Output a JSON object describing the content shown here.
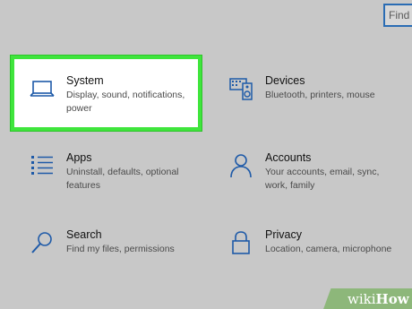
{
  "search": {
    "value": "Find"
  },
  "tiles": [
    {
      "title": "System",
      "desc": "Display, sound, notifications, power",
      "icon": "laptop-icon"
    },
    {
      "title": "Devices",
      "desc": "Bluetooth, printers, mouse",
      "icon": "keyboard-speaker-icon"
    },
    {
      "title": "Apps",
      "desc": "Uninstall, defaults, optional features",
      "icon": "apps-list-icon"
    },
    {
      "title": "Accounts",
      "desc": "Your accounts, email, sync, work, family",
      "icon": "person-icon"
    },
    {
      "title": "Search",
      "desc": "Find my files, permissions",
      "icon": "magnifier-icon"
    },
    {
      "title": "Privacy",
      "desc": "Location, camera, microphone",
      "icon": "lock-icon"
    }
  ],
  "watermark": {
    "prefix": "wiki",
    "suffix": "How"
  },
  "colors": {
    "accent": "#1e5aa8",
    "highlight_border": "#3fe53c"
  }
}
